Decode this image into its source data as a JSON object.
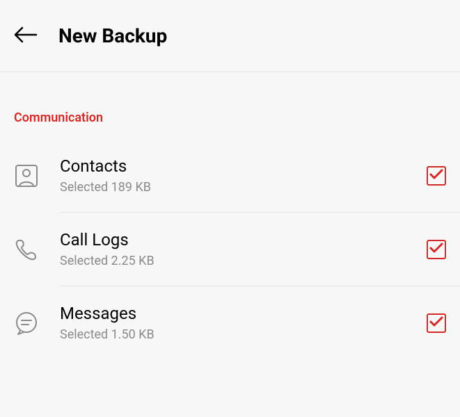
{
  "header": {
    "title": "New Backup"
  },
  "section": {
    "label": "Communication"
  },
  "items": [
    {
      "title": "Contacts",
      "subtitle": "Selected 189 KB"
    },
    {
      "title": "Call Logs",
      "subtitle": "Selected 2.25 KB"
    },
    {
      "title": "Messages",
      "subtitle": "Selected 1.50 KB"
    }
  ]
}
